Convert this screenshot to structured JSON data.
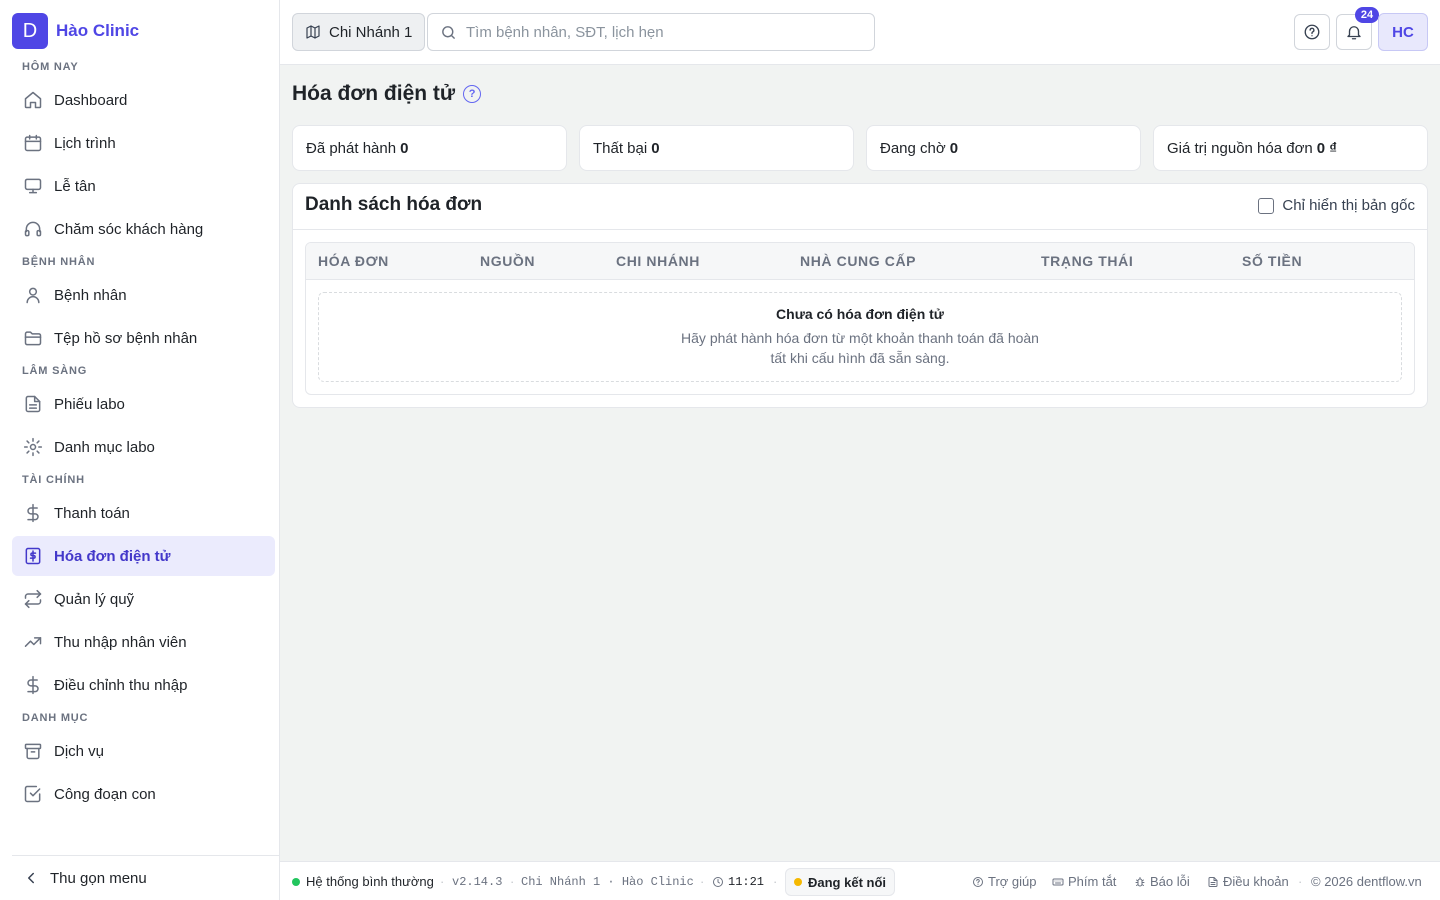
{
  "brand": {
    "logo_letter": "D",
    "name": "Hào Clinic",
    "accent": "#4f46e5"
  },
  "sidebar": {
    "sections": [
      {
        "title": "HÔM NAY",
        "items": [
          {
            "label": "Dashboard",
            "icon": "home-icon"
          },
          {
            "label": "Lịch trình",
            "icon": "calendar-icon"
          },
          {
            "label": "Lễ tân",
            "icon": "monitor-icon"
          },
          {
            "label": "Chăm sóc khách hàng",
            "icon": "headphones-icon"
          }
        ]
      },
      {
        "title": "BỆNH NHÂN",
        "items": [
          {
            "label": "Bệnh nhân",
            "icon": "user-icon"
          },
          {
            "label": "Tệp hồ sơ bệnh nhân",
            "icon": "folder-icon"
          }
        ]
      },
      {
        "title": "LÂM SÀNG",
        "items": [
          {
            "label": "Phiếu labo",
            "icon": "document-icon"
          },
          {
            "label": "Danh mục labo",
            "icon": "gear-icon"
          }
        ]
      },
      {
        "title": "TÀI CHÍNH",
        "items": [
          {
            "label": "Thanh toán",
            "icon": "dollar-icon"
          },
          {
            "label": "Hóa đơn điện tử",
            "icon": "invoice-icon",
            "active": true
          },
          {
            "label": "Quản lý quỹ",
            "icon": "transfer-icon"
          },
          {
            "label": "Thu nhập nhân viên",
            "icon": "trending-up-icon"
          },
          {
            "label": "Điều chỉnh thu nhập",
            "icon": "dollar-icon"
          }
        ]
      },
      {
        "title": "DANH MỤC",
        "items": [
          {
            "label": "Dịch vụ",
            "icon": "archive-icon"
          },
          {
            "label": "Công đoạn con",
            "icon": "checkbox-icon"
          }
        ]
      }
    ],
    "collapse_label": "Thu gọn menu"
  },
  "topbar": {
    "branch_label": "Chi Nhánh 1",
    "search_placeholder": "Tìm bệnh nhân, SĐT, lịch hẹn",
    "notification_count": "24",
    "avatar_initials": "HC"
  },
  "page": {
    "title": "Hóa đơn điện tử",
    "help_mark": "?",
    "stats": [
      {
        "label": "Đã phát hành",
        "value": "0"
      },
      {
        "label": "Thất bại",
        "value": "0"
      },
      {
        "label": "Đang chờ",
        "value": "0"
      },
      {
        "label": "Giá trị nguồn hóa đơn",
        "value": "0 ₫"
      }
    ],
    "list": {
      "title": "Danh sách hóa đơn",
      "toggle_label": "Chỉ hiển thị bản gốc",
      "columns": [
        "HÓA ĐƠN",
        "NGUỒN",
        "CHI NHÁNH",
        "NHÀ CUNG CẤP",
        "TRẠNG THÁI",
        "SỐ TIỀN"
      ],
      "empty_title": "Chưa có hóa đơn điện tử",
      "empty_desc": "Hãy phát hành hóa đơn từ một khoản thanh toán đã hoàn tất khi cấu hình đã sẵn sàng."
    }
  },
  "footer": {
    "status": "Hệ thống bình thường",
    "status_color": "#22c55e",
    "version": "v2.14.3",
    "branch_clinic": "Chi Nhánh 1 · Hào Clinic",
    "time": "11:21",
    "connection": "Đang kết nối",
    "connection_color": "#f5b800",
    "help": "Trợ giúp",
    "shortcuts": "Phím tắt",
    "report_bug": "Báo lỗi",
    "terms": "Điều khoản",
    "copyright": "© 2026 dentflow.vn"
  }
}
